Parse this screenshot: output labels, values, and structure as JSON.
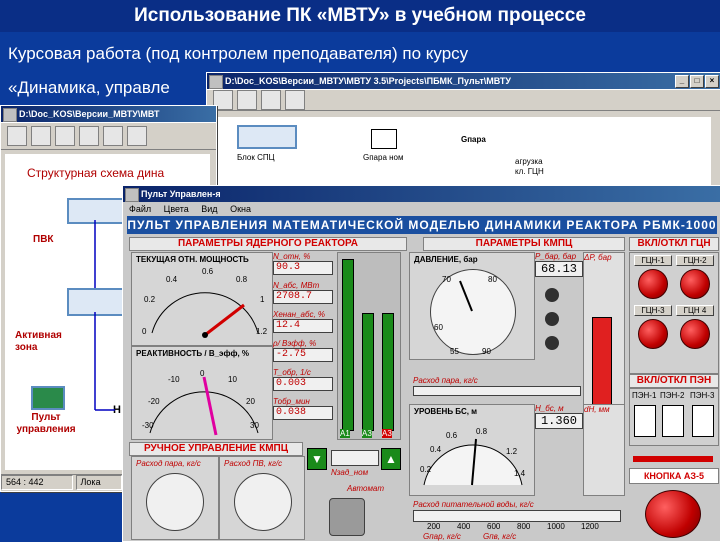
{
  "slide": {
    "title": "Использование ПК «МВТУ» в учебном процессе",
    "line1": "Курсовая работа (под контролем преподавателя) по курсу",
    "line2": "«Динамика, управле"
  },
  "win_back": {
    "title": "D:\\Doc_KOS\\Версии_МВТУ\\МВТУ 3.5\\Projects\\ПБМК_Пульт\\МВТУ",
    "blocks": [
      "Блок СПЦ",
      "Gпара ном",
      "Gпара"
    ],
    "right_labels": [
      "агрузка",
      "кл. ГЦН"
    ]
  },
  "win_mid": {
    "title": "D:\\Doc_KOS\\Версии_МВТУ\\МВТ",
    "heading": "Структурная схема дина",
    "labels": {
      "pvk": "ПВК",
      "active_zone": "Активная зона",
      "control_panel": "Пульт управления",
      "n": "Н"
    },
    "status": [
      "564 : 442",
      "Лока"
    ]
  },
  "pult": {
    "title": "Пульт Управлен-я",
    "menu": [
      "Файл",
      "Цвета",
      "Вид",
      "Окна"
    ],
    "banner": "ПУЛЬТ УПРАВЛЕНИЯ МАТЕМАТИЧЕСКОЙ МОДЕЛЬЮ ДИНАМИКИ РЕАКТОРА РБМК-1000",
    "sec_reactor": "ПАРАМЕТРЫ ЯДЕРНОГО РЕАКТОРА",
    "sec_kmpc": "ПАРАМЕТРЫ КМПЦ",
    "sec_gcn": "ВКЛ/ОТКЛ ГЦН",
    "sec_pen": "ВКЛ/ОТКЛ ПЭН",
    "sec_manual": "РУЧНОЕ УПРАВЛЕНИЕ КМПЦ",
    "power_gauge": {
      "label": "ТЕКУЩАЯ  ОТН.  МОЩНОСТЬ",
      "ticks": [
        "0.4",
        "0.6",
        "0.8",
        "0.2",
        "1",
        "0",
        "1.2"
      ]
    },
    "react_gauge": {
      "label": "РЕАКТИВНОСТЬ / В_эфф, %",
      "ticks": [
        "-10",
        "0",
        "10",
        "-20",
        "20",
        "-30",
        "30"
      ]
    },
    "readouts": [
      {
        "label": "N_отн, %",
        "value": "90.3"
      },
      {
        "label": "N_абс, МВт",
        "value": "2708.7"
      },
      {
        "label": "Xeнaн_абс, %",
        "value": "12.4"
      },
      {
        "label": "ρ/ Вэфф, %",
        "value": "-2.75"
      },
      {
        "label": "T_обр, 1/с",
        "value": "0.003"
      },
      {
        "label": "Тобр_мин",
        "value": "0.038"
      }
    ],
    "bar_labels": [
      "A1",
      "A3",
      "A3"
    ],
    "pressure": {
      "label": "ДАВЛЕНИЕ, бар",
      "ticks": [
        "70",
        "80",
        "60",
        "70",
        "55",
        "90"
      ],
      "p_label": "P_бар, бар",
      "p_value": "68.13",
      "dp_label": "ΔP, бар"
    },
    "steam_label": "Расход пара, кг/с",
    "level": {
      "label": "УРОВЕНЬ БС, м",
      "ticks": [
        "0.6",
        "0.8",
        "0.4",
        "1.2",
        "0.2",
        "1.4"
      ],
      "h_label": "Н_бс, м",
      "h_value": "1.360",
      "dh_label": "dH, мм"
    },
    "feed_label": "Расход питательной воды, кг/с",
    "feed_ticks": [
      "200",
      "400",
      "600",
      "800",
      "1000",
      "1200"
    ],
    "bottom_labels": [
      "Gпар, кг/с",
      "Gпв, кг/с"
    ],
    "gcn_buttons": [
      "ГЦН-1",
      "ГЦН-2",
      "ГЦН-3",
      "ГЦН 4"
    ],
    "pen_buttons": [
      "ПЭН-1",
      "ПЭН-2",
      "ПЭН-3"
    ],
    "az5": "КНОПКА АЗ-5",
    "manual": {
      "left_label": "Расход пара, кг/с",
      "right_label": "Расход ПВ, кг/с",
      "n_label": "Nзад_ном",
      "auto": "Автомат"
    },
    "side_labels": [
      "0.4",
      "0.2",
      "4"
    ]
  },
  "colors": {
    "slide_bg": "#0b3b9c",
    "banner": "#1a4fa0",
    "red": "#d10000",
    "green": "#1a8a1a"
  }
}
